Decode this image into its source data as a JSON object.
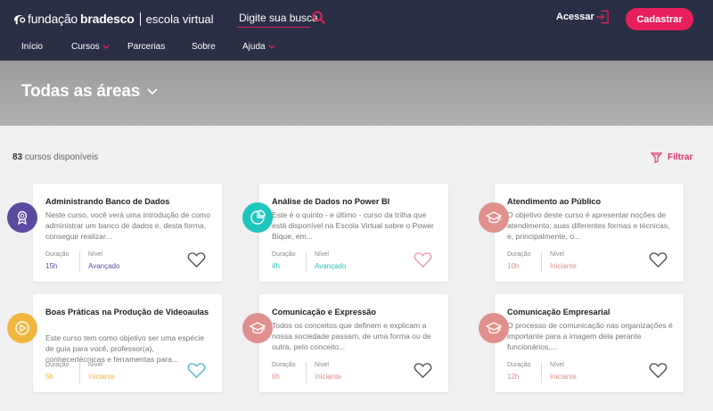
{
  "header": {
    "brand_a": "fundação",
    "brand_b": "bradesco",
    "brand_c": "escola virtual",
    "search_placeholder": "Digite sua busca",
    "login_label": "Acessar",
    "register_label": "Cadastrar",
    "nav": [
      "Início",
      "Cursos",
      "Parcerias",
      "Sobre",
      "Ajuda"
    ]
  },
  "banner": {
    "title": "Todas as áreas"
  },
  "results": {
    "count": "83",
    "count_label": "cursos disponíveis",
    "filter_label": "Filtrar"
  },
  "labels": {
    "duration": "Duração",
    "level": "Nível"
  },
  "colors": {
    "header_bg": "#2b2f45",
    "accent": "#e81f5c",
    "purple": "#5b4aa0",
    "teal": "#1ec6be",
    "salmon": "#e0908c",
    "yellow": "#f2b640"
  },
  "cards": [
    {
      "title": "Administrando Banco de Dados",
      "desc": "Neste curso, você verá uma introdução de como administrar um banco de dados e, desta forma, conseguir realizar...",
      "duration": "15h",
      "level": "Avançado",
      "icon": "medal-icon",
      "color": "#5b4aa0"
    },
    {
      "title": "Análise de Dados no Power BI",
      "desc": "Este é o quinto - e último - curso da trilha que está disponível na Escola Virtual sobre o Power Bique, em...",
      "duration": "4h",
      "level": "Avançado",
      "icon": "pie-chart-icon",
      "color": "#1ec6be"
    },
    {
      "title": "Atendimento ao Público",
      "desc": "O objetivo deste curso é apresentar noções de atendimento, suas diferentes formas e técnicas, e, principalmente, o...",
      "duration": "10h",
      "level": "Iniciante",
      "icon": "graduation-cap-icon",
      "color": "#e0908c"
    },
    {
      "title": "Boas Práticas na Produção de Videoaulas",
      "desc": "Este curso tem como objetivo ser uma espécie de guia para você, professor(a), conhecertécnicas e ferramentas para...",
      "duration": "5h",
      "level": "Iniciante",
      "icon": "play-icon",
      "color": "#f2b640"
    },
    {
      "title": "Comunicação e Expressão",
      "desc": "Todos os conceitos que definem e explicam a nossa sociedade passam, de uma forma ou de outra, pelo conceito...",
      "duration": "6h",
      "level": "Iniciante",
      "icon": "graduation-cap-icon",
      "color": "#e0908c"
    },
    {
      "title": "Comunicação Empresarial",
      "desc": "O processo de comunicação nas organizações é importante para a imagem dela perante funcionários,...",
      "duration": "12h",
      "level": "Iniciante",
      "icon": "graduation-cap-icon",
      "color": "#e0908c"
    }
  ]
}
